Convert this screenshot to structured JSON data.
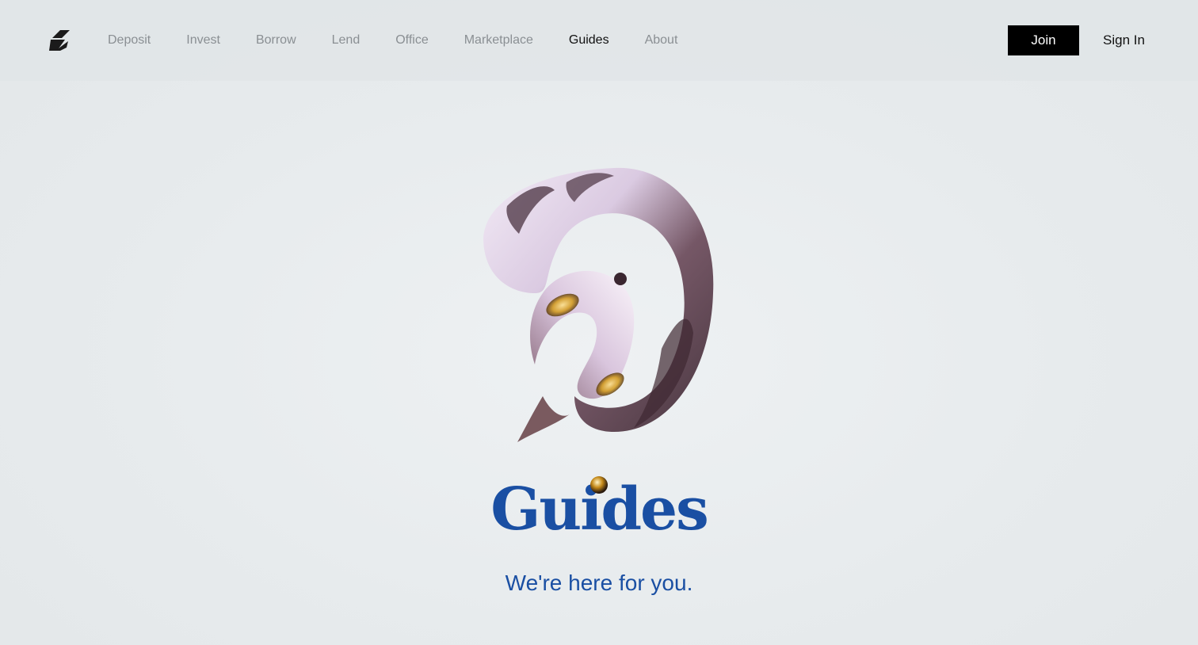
{
  "nav": {
    "items": [
      {
        "label": "Deposit",
        "active": false
      },
      {
        "label": "Invest",
        "active": false
      },
      {
        "label": "Borrow",
        "active": false
      },
      {
        "label": "Lend",
        "active": false
      },
      {
        "label": "Office",
        "active": false
      },
      {
        "label": "Marketplace",
        "active": false
      },
      {
        "label": "Guides",
        "active": true
      },
      {
        "label": "About",
        "active": false
      }
    ]
  },
  "header": {
    "join_label": "Join",
    "signin_label": "Sign In",
    "logo_icon": "brand-logo-icon"
  },
  "hero": {
    "title": "Guides",
    "subtitle": "We're here for you.",
    "art_icon": "chrome-ribbon-swirl"
  },
  "colors": {
    "accent": "#1a4fa3",
    "background": "#e8ecee",
    "nav_inactive": "#8a8f93",
    "nav_active": "#111111",
    "join_bg": "#000000"
  }
}
